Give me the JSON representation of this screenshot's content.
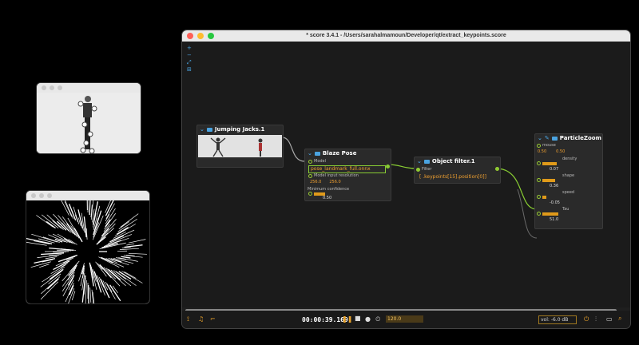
{
  "main_window": {
    "title": "* score 3.4.1 - /Users/sarahalmamoun/Developer/qt/extract_keypoints.score"
  },
  "nodes": {
    "jumping_jacks": {
      "title": "Jumping Jacks.1"
    },
    "blaze_pose": {
      "title": "Blaze Pose",
      "model_label": "Model",
      "model_value": "pose_landmark_full.onnx",
      "resolution_label": "Model input resolution",
      "resolution_w": "256.0",
      "resolution_h": "256.0",
      "confidence_label": "Minimum confidence",
      "confidence_value": "0.50",
      "confidence_level": 0.5
    },
    "object_filter": {
      "title": "Object filter.1",
      "filter_label": "Filter",
      "filter_value": "[ .keypoints[15].position[0]]"
    },
    "particle_zoom": {
      "title": "ParticleZoom",
      "mouse_label": "mouse",
      "mouse_x": "0.50",
      "mouse_y": "0.50",
      "params": [
        {
          "name": "density",
          "value": "0.07",
          "level": 0.5
        },
        {
          "name": "shape",
          "value": "0.36",
          "level": 0.45
        },
        {
          "name": "speed",
          "value": "-0.05",
          "level": 0.15
        },
        {
          "name": "Tau",
          "value": "51.0",
          "level": 0.55
        }
      ]
    }
  },
  "transport": {
    "time": "00:00:39.169",
    "tempo": "120.0",
    "volume": "vol: -6.0 dB"
  },
  "colors": {
    "accent_blue": "#4aa3e0",
    "accent_orange": "#e09a1a",
    "cable_green": "#8c3"
  }
}
